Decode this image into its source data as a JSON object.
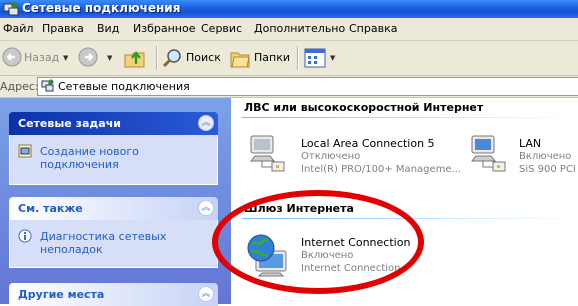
{
  "window": {
    "title": "Сетевые подключения"
  },
  "menu": [
    "Файл",
    "Правка",
    "Вид",
    "Избранное",
    "Сервис",
    "Дополнительно",
    "Справка"
  ],
  "toolbar": {
    "back_label": "Назад",
    "search_label": "Поиск",
    "folders_label": "Папки"
  },
  "address": {
    "label": "Адрес:",
    "value": "Сетевые подключения"
  },
  "sidebar": {
    "network_tasks": {
      "title": "Сетевые задачи",
      "items": [
        "Создание нового подключения"
      ]
    },
    "see_also": {
      "title": "См. также",
      "items": [
        "Диагностика сетевых неполадок"
      ]
    },
    "other_places": {
      "title": "Другие места"
    }
  },
  "groups": {
    "lan": {
      "title": "ЛВС или высокоскоростной Интернет",
      "items": [
        {
          "name": "Local Area Connection 5",
          "status": "Отключено",
          "device": "Intel(R) PRO/100+ Manageme..."
        },
        {
          "name": "LAN",
          "status": "Включено",
          "device": "SiS 900 PCI"
        }
      ]
    },
    "gateway": {
      "title": "Шлюз Интернета",
      "items": [
        {
          "name": "Internet Connection",
          "status": "Включено",
          "device": "Internet Connection"
        }
      ]
    }
  },
  "colors": {
    "highlight": "#e30000",
    "title_bar": "#1b5fe0",
    "task_link": "#215dc6"
  }
}
